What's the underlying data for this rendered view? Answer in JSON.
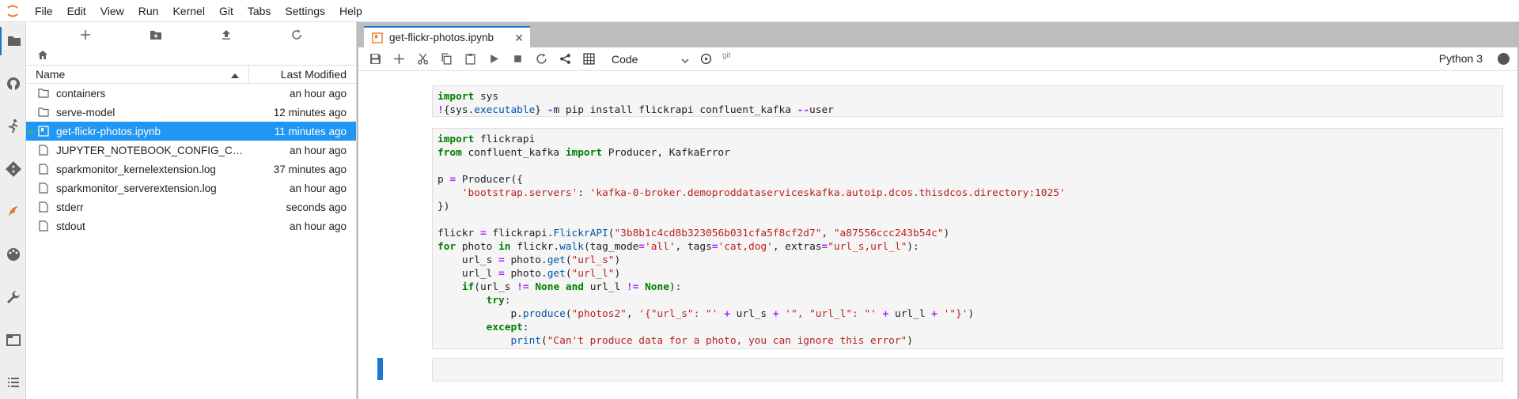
{
  "menu": [
    "File",
    "Edit",
    "View",
    "Run",
    "Kernel",
    "Git",
    "Tabs",
    "Settings",
    "Help"
  ],
  "filebrowser": {
    "col_name": "Name",
    "col_modified": "Last Modified",
    "files": [
      {
        "name": "containers",
        "type": "folder",
        "modified": "an hour ago"
      },
      {
        "name": "serve-model",
        "type": "folder",
        "modified": "12 minutes ago"
      },
      {
        "name": "get-flickr-photos.ipynb",
        "type": "notebook",
        "modified": "11 minutes ago",
        "selected": true
      },
      {
        "name": "JUPYTER_NOTEBOOK_CONFIG_COMP...",
        "type": "file",
        "modified": "an hour ago"
      },
      {
        "name": "sparkmonitor_kernelextension.log",
        "type": "file",
        "modified": "37 minutes ago"
      },
      {
        "name": "sparkmonitor_serverextension.log",
        "type": "file",
        "modified": "an hour ago"
      },
      {
        "name": "stderr",
        "type": "file",
        "modified": "seconds ago"
      },
      {
        "name": "stdout",
        "type": "file",
        "modified": "an hour ago"
      }
    ]
  },
  "tab": {
    "title": "get-flickr-photos.ipynb"
  },
  "toolbar": {
    "cell_type": "Code",
    "git_label": "git",
    "kernel_name": "Python 3"
  },
  "cells": {
    "c1": {
      "prompt": "[ ]:"
    },
    "c2": {
      "prompt": "[*]:"
    },
    "c3": {
      "prompt": "[ ]:"
    }
  },
  "colors": {
    "accent": "#1976d2",
    "selected_row": "#2196f3",
    "keyword": "#008000",
    "string": "#ba2121"
  }
}
